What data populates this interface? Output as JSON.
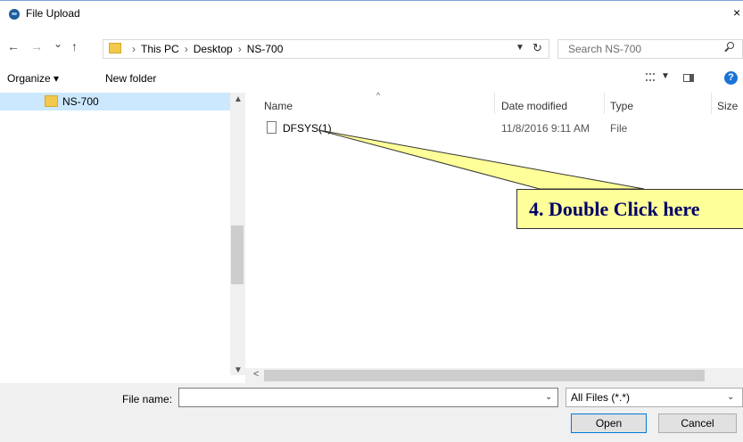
{
  "window": {
    "title": "File Upload",
    "close_glyph": "×"
  },
  "navigation": {
    "back_glyph": "←",
    "forward_glyph": "→",
    "recent_glyph": "⌄",
    "up_glyph": "↑",
    "breadcrumb": [
      "This PC",
      "Desktop",
      "NS-700"
    ],
    "separator": "›",
    "refresh_glyph": "↻"
  },
  "search": {
    "placeholder": "Search NS-700"
  },
  "toolbar": {
    "organize_label": "Organize ▾",
    "new_folder_label": "New folder",
    "help_glyph": "?"
  },
  "nav_pane": {
    "items": [
      {
        "label": "NS-700",
        "selected": true
      }
    ]
  },
  "file_list": {
    "columns": [
      "Name",
      "Date modified",
      "Type",
      "Size"
    ],
    "rows": [
      {
        "name": "DFSYS(1)",
        "date_modified": "11/8/2016 9:11 AM",
        "type": "File",
        "size": ""
      }
    ]
  },
  "footer": {
    "file_name_label": "File name:",
    "file_name_value": "",
    "file_type_value": "All Files (*.*)",
    "open_label": "Open",
    "cancel_label": "Cancel"
  },
  "annotation": {
    "text": "4. Double Click here"
  },
  "colors": {
    "selection": "#cce8ff",
    "callout_fill": "#ffff99",
    "callout_text": "#000066",
    "accent": "#0078d7"
  }
}
